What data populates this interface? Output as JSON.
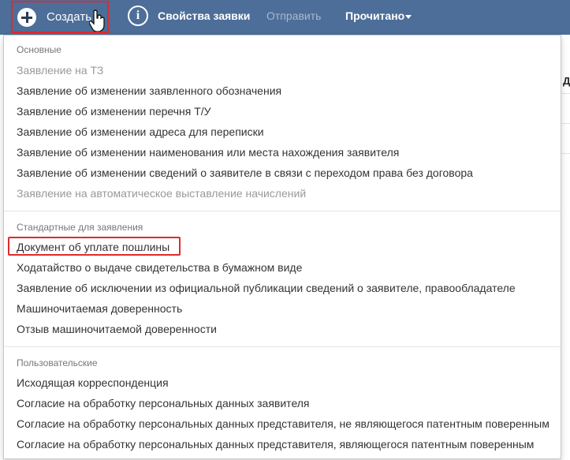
{
  "toolbar": {
    "create_label": "Создать",
    "properties_label": "Свойства заявки",
    "send_label": "Отправить",
    "read_label": "Прочитано"
  },
  "icons": {
    "create": "plus-circle-icon",
    "info": "info-circle-icon",
    "cursor": "hand-pointer-icon",
    "caret": "caret-down-icon"
  },
  "info_glyph": "i",
  "colors": {
    "topbar": "#4d6e99",
    "highlight_border": "#e02a2a",
    "disabled_text": "#999999",
    "section_header": "#777777"
  },
  "menu": {
    "sections": [
      {
        "header": "Основные",
        "items": [
          {
            "label": "Заявление на ТЗ",
            "disabled": true
          },
          {
            "label": "Заявление об изменении заявленного обозначения",
            "disabled": false
          },
          {
            "label": "Заявление об изменении перечня Т/У",
            "disabled": false
          },
          {
            "label": "Заявление об изменении адреса для переписки",
            "disabled": false
          },
          {
            "label": "Заявление об изменении наименования или места нахождения заявителя",
            "disabled": false
          },
          {
            "label": "Заявление об изменении сведений о заявителе в связи с переходом права без договора",
            "disabled": false
          },
          {
            "label": "Заявление на автоматическое выставление начислений",
            "disabled": true
          }
        ]
      },
      {
        "header": "Стандартные для заявления",
        "items": [
          {
            "label": "Документ об уплате пошлины",
            "disabled": false,
            "highlighted": true
          },
          {
            "label": "Ходатайство о выдаче свидетельства в бумажном виде",
            "disabled": false
          },
          {
            "label": "Заявление об исключении из официальной публикации сведений о заявителе, правообладателе",
            "disabled": false
          },
          {
            "label": "Машиночитаемая доверенность",
            "disabled": false
          },
          {
            "label": "Отзыв машиночитаемой доверенности",
            "disabled": false
          }
        ]
      },
      {
        "header": "Пользовательские",
        "items": [
          {
            "label": "Исходящая корреспонденция",
            "disabled": false
          },
          {
            "label": "Согласие на обработку персональных данных заявителя",
            "disabled": false
          },
          {
            "label": "Согласие на обработку персональных данных представителя, не являющегося патентным поверенным",
            "disabled": false
          },
          {
            "label": "Согласие на обработку персональных данных представителя, являющегося патентным поверенным",
            "disabled": false
          }
        ]
      }
    ]
  },
  "background": {
    "stub_text": "Д"
  }
}
